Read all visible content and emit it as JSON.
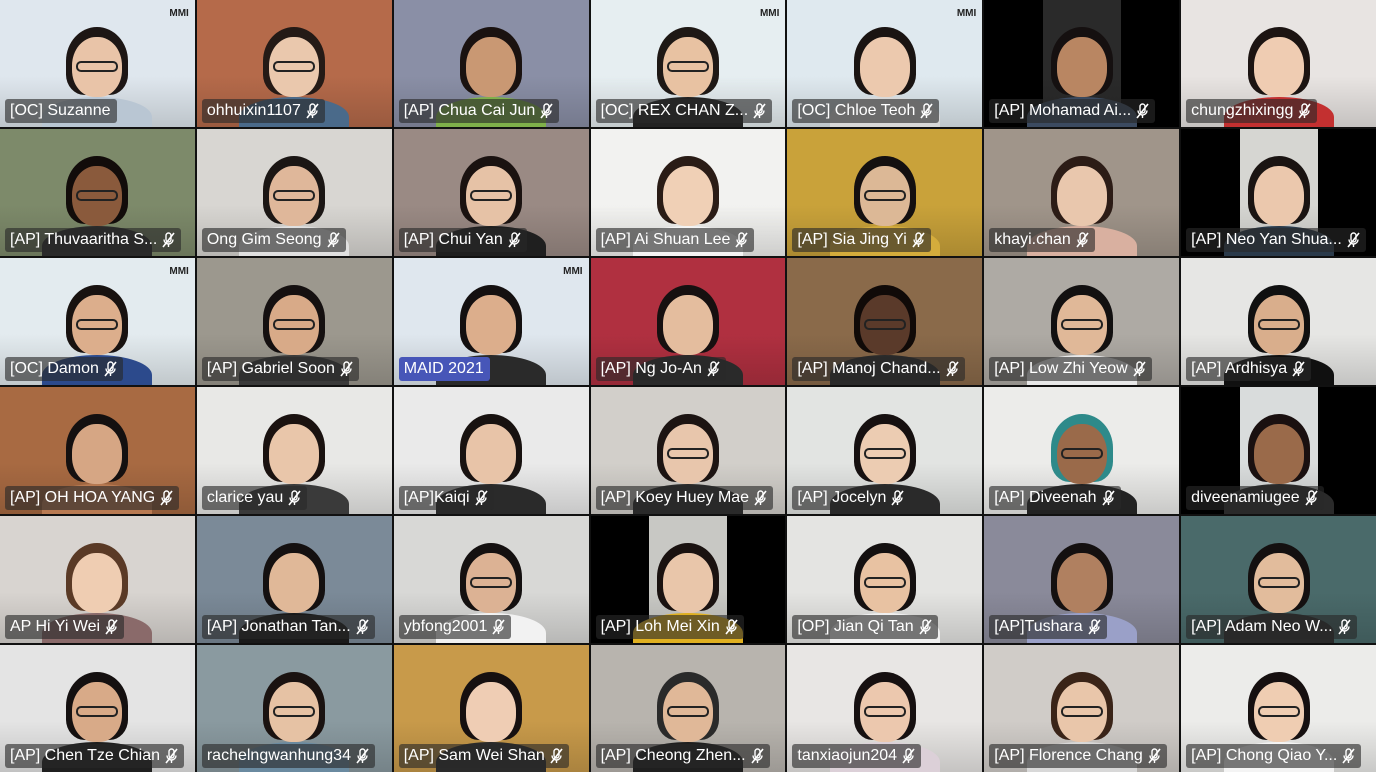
{
  "meeting": {
    "tiles": [
      {
        "label": "[OC] Suzanne",
        "muted": false,
        "bg": "#dfe7ee",
        "skin": "#e9c4a8",
        "hair": "#1d1614",
        "shirt": "#b9c6d3",
        "glasses": true,
        "logo": "MMI"
      },
      {
        "label": "ohhuixin1107",
        "muted": true,
        "bg": "#b56a4a",
        "skin": "#eac8ad",
        "hair": "#241a16",
        "shirt": "#4a6a8a",
        "glasses": true
      },
      {
        "label": "[AP] Chua Cai Jun",
        "muted": true,
        "bg": "#8a8fa6",
        "skin": "#c99873",
        "hair": "#1a1210",
        "shirt": "#7fb04a",
        "glasses": false
      },
      {
        "label": "[OC] REX CHAN Z...",
        "muted": true,
        "bg": "#e6eef1",
        "skin": "#e8c2a2",
        "hair": "#1e1815",
        "shirt": "#222222",
        "glasses": true,
        "logo": "MMI"
      },
      {
        "label": "[OC] Chloe Teoh",
        "muted": true,
        "bg": "#dfe9ef",
        "skin": "#ecc9ae",
        "hair": "#1a1412",
        "shirt": "#d8d8d8",
        "glasses": false,
        "logo": "MMI"
      },
      {
        "label": "[AP] Mohamad Ai...",
        "muted": true,
        "bg": "#2a2a2a",
        "skin": "#b98662",
        "hair": "#151010",
        "shirt": "#3b4a60",
        "glasses": false,
        "blind": true
      },
      {
        "label": "chungzhixingg",
        "muted": true,
        "bg": "#e8e4e2",
        "skin": "#efccb2",
        "hair": "#1c1412",
        "shirt": "#c33030",
        "glasses": false
      },
      {
        "label": "[AP] Thuvaaritha S...",
        "muted": true,
        "bg": "#7d8a6a",
        "skin": "#8a5a3c",
        "hair": "#120c0a",
        "shirt": "#2a2a2a",
        "glasses": true
      },
      {
        "label": "Ong Gim Seong",
        "muted": true,
        "bg": "#d8d6d2",
        "skin": "#dfb79a",
        "hair": "#1b1614",
        "shirt": "#e0e0e0",
        "glasses": true
      },
      {
        "label": "[AP] Chui Yan",
        "muted": true,
        "bg": "#9a8a84",
        "skin": "#e6c2a6",
        "hair": "#1a1210",
        "shirt": "#1f1f1f",
        "glasses": true
      },
      {
        "label": "[AP] Ai Shuan Lee",
        "muted": true,
        "bg": "#f2f2f0",
        "skin": "#f0d0b6",
        "hair": "#2a1c16",
        "shirt": "#f4f4f4",
        "glasses": false
      },
      {
        "label": "[AP] Sia Jing Yi",
        "muted": true,
        "bg": "#c9a23a",
        "skin": "#dcb896",
        "hair": "#141010",
        "shirt": "#d4ac3c",
        "glasses": true
      },
      {
        "label": "khayi.chan",
        "muted": true,
        "bg": "#a0958a",
        "skin": "#e9c7ad",
        "hair": "#2c1c16",
        "shirt": "#d9b0a0",
        "glasses": false
      },
      {
        "label": "[AP] Neo Yan Shua...",
        "muted": true,
        "bg": "#d6d6d2",
        "skin": "#ebc8ad",
        "hair": "#1a1412",
        "shirt": "#2a3a4a",
        "glasses": false,
        "blind": true
      },
      {
        "label": "[OC] Damon",
        "muted": true,
        "bg": "#e3ebef",
        "skin": "#dcae8c",
        "hair": "#181210",
        "shirt": "#2c4a8c",
        "glasses": true,
        "logo": "MMI"
      },
      {
        "label": "[AP] Gabriel Soon",
        "muted": true,
        "bg": "#9c988e",
        "skin": "#d8aa88",
        "hair": "#151010",
        "shirt": "#3a3a3a",
        "glasses": true
      },
      {
        "label": "MAID 2021",
        "muted": false,
        "blue": true,
        "bg": "#dfe7ee",
        "skin": "#dcae8c",
        "hair": "#141010",
        "shirt": "#2a2a2a",
        "glasses": false,
        "logo": "MMI"
      },
      {
        "label": "[AP] Ng Jo-An",
        "muted": true,
        "bg": "#b03040",
        "skin": "#e4bd9e",
        "hair": "#161010",
        "shirt": "#2a2a2a",
        "glasses": false
      },
      {
        "label": "[AP] Manoj Chand...",
        "muted": true,
        "bg": "#8a6a4a",
        "skin": "#5a3a2a",
        "hair": "#100a08",
        "shirt": "#2a2a2a",
        "glasses": true
      },
      {
        "label": "[AP] Low Zhi Yeow",
        "muted": true,
        "bg": "#aeaaa4",
        "skin": "#e0b898",
        "hair": "#121010",
        "shirt": "#e8e8e8",
        "glasses": true
      },
      {
        "label": "[AP] Ardhisya",
        "muted": true,
        "bg": "#e6e6e4",
        "skin": "#d9ae8c",
        "hair": "#101010",
        "shirt": "#101010",
        "glasses": true
      },
      {
        "label": "[AP] OH HOA YANG",
        "muted": true,
        "bg": "#a86a42",
        "skin": "#d6a684",
        "hair": "#141010",
        "shirt": "#b87a52",
        "glasses": false
      },
      {
        "label": "clarice yau",
        "muted": true,
        "bg": "#e8e8e6",
        "skin": "#e9c6aa",
        "hair": "#1a1210",
        "shirt": "#3a3a3a",
        "glasses": false
      },
      {
        "label": "[AP]Kaiqi",
        "muted": true,
        "bg": "#eaeaea",
        "skin": "#e8c4a8",
        "hair": "#181210",
        "shirt": "#2a2a2a",
        "glasses": false
      },
      {
        "label": "[AP] Koey Huey Mae",
        "muted": true,
        "bg": "#d2cfca",
        "skin": "#e8c6ac",
        "hair": "#1c1412",
        "shirt": "#2a2a2a",
        "glasses": true
      },
      {
        "label": "[AP] Jocelyn",
        "muted": true,
        "bg": "#e2e4e2",
        "skin": "#ecccb2",
        "hair": "#161010",
        "shirt": "#2a2a2a",
        "glasses": true
      },
      {
        "label": "[AP] Diveenah",
        "muted": true,
        "bg": "#ececea",
        "skin": "#9a6a4a",
        "hair": "#2e8a8a",
        "shirt": "#222222",
        "glasses": true
      },
      {
        "label": "diveenamiugee",
        "muted": true,
        "bg": "#d9dcdc",
        "skin": "#9a6a4a",
        "hair": "#1a1010",
        "shirt": "#2a2a2a",
        "glasses": false,
        "blind": true
      },
      {
        "label": "AP Hi Yi Wei",
        "muted": true,
        "bg": "#d8d4d0",
        "skin": "#efcdb2",
        "hair": "#5a3a26",
        "shirt": "#8a6a6a",
        "glasses": false
      },
      {
        "label": "[AP] Jonathan Tan...",
        "muted": true,
        "bg": "#7b8a98",
        "skin": "#e0b898",
        "hair": "#141010",
        "shirt": "#1a1a1a",
        "glasses": false
      },
      {
        "label": "ybfong2001",
        "muted": true,
        "bg": "#d8d8d6",
        "skin": "#dcb294",
        "hair": "#141010",
        "shirt": "#f2f2f2",
        "glasses": true
      },
      {
        "label": "[AP] Loh Mei Xin",
        "muted": true,
        "bg": "#c8c8c4",
        "skin": "#e9c6aa",
        "hair": "#1a1210",
        "shirt": "#e0b020",
        "glasses": false,
        "blind": true
      },
      {
        "label": "[OP] Jian Qi Tan",
        "muted": true,
        "bg": "#e4e4e2",
        "skin": "#e8c2a2",
        "hair": "#141010",
        "shirt": "#f0f0f0",
        "glasses": true
      },
      {
        "label": "[AP]Tushara",
        "muted": true,
        "bg": "#8a8a9a",
        "skin": "#b08060",
        "hair": "#141010",
        "shirt": "#9aa0c8",
        "glasses": false
      },
      {
        "label": "[AP] Adam Neo W...",
        "muted": true,
        "bg": "#4a6a6a",
        "skin": "#e2bc9c",
        "hair": "#141010",
        "shirt": "#2a2a2a",
        "glasses": true
      },
      {
        "label": "[AP] Chen Tze Chian",
        "muted": true,
        "bg": "#e4e4e4",
        "skin": "#d8aa88",
        "hair": "#141010",
        "shirt": "#1f1f1f",
        "glasses": true
      },
      {
        "label": "rachelngwanhung34",
        "muted": true,
        "bg": "#8a9aa0",
        "skin": "#e6c2a4",
        "hair": "#1a1210",
        "shirt": "#6a8aa0",
        "glasses": true
      },
      {
        "label": "[AP] Sam Wei Shan",
        "muted": true,
        "bg": "#c89a4a",
        "skin": "#efcdb4",
        "hair": "#161010",
        "shirt": "#2a2a2a",
        "glasses": false
      },
      {
        "label": "[AP] Cheong Zhen...",
        "muted": true,
        "bg": "#b8b4ae",
        "skin": "#e0b898",
        "hair": "#2a2a2a",
        "shirt": "#1f1f1f",
        "glasses": true
      },
      {
        "label": "tanxiaojun204",
        "muted": true,
        "bg": "#e8e6e4",
        "skin": "#ecc8ae",
        "hair": "#161010",
        "shirt": "#dcd0d8",
        "glasses": true
      },
      {
        "label": "[AP] Florence Chang",
        "muted": true,
        "bg": "#d0ccc8",
        "skin": "#e9c6aa",
        "hair": "#3a2418",
        "shirt": "#d8d8d8",
        "glasses": true
      },
      {
        "label": "[AP] Chong Qiao Y...",
        "muted": true,
        "bg": "#ececea",
        "skin": "#efcdb2",
        "hair": "#161010",
        "shirt": "#f4f4f4",
        "glasses": true
      }
    ]
  }
}
